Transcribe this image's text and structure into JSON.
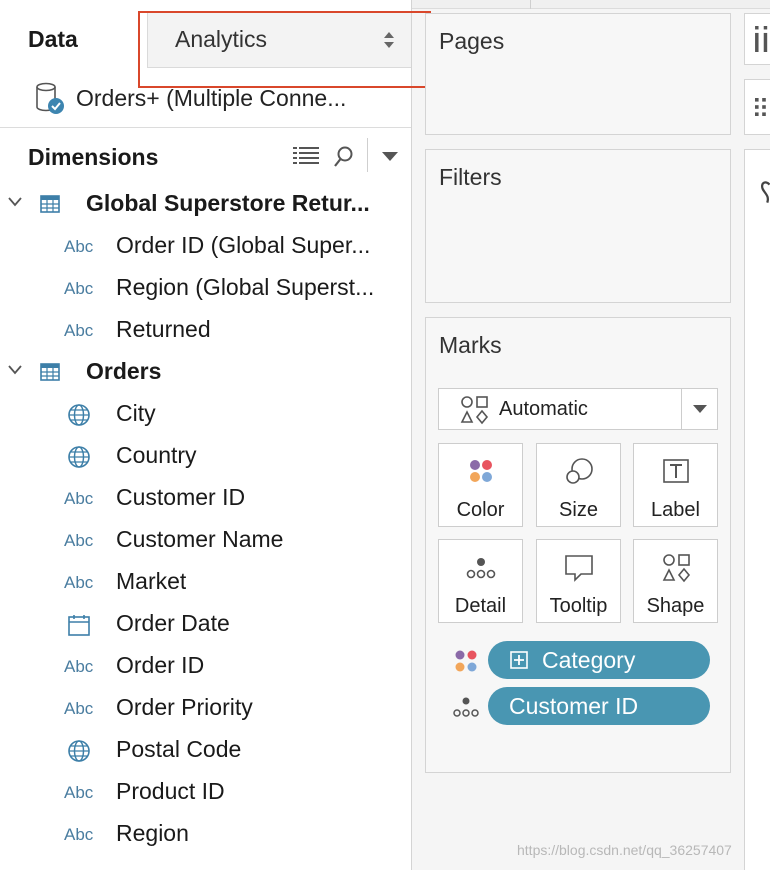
{
  "data_pane": {
    "tab_data": "Data",
    "tab_analytics": "Analytics",
    "datasource": "Orders+ (Multiple Conne...",
    "dimensions_title": "Dimensions"
  },
  "groups": [
    {
      "label": "Global Superstore Retur...",
      "fields": [
        {
          "type": "Abc",
          "name": "Order ID (Global Super..."
        },
        {
          "type": "Abc",
          "name": "Region (Global Superst..."
        },
        {
          "type": "Abc",
          "name": "Returned"
        }
      ]
    },
    {
      "label": "Orders",
      "fields": [
        {
          "type": "geo",
          "name": "City"
        },
        {
          "type": "geo",
          "name": "Country"
        },
        {
          "type": "Abc",
          "name": "Customer ID"
        },
        {
          "type": "Abc",
          "name": "Customer Name"
        },
        {
          "type": "Abc",
          "name": "Market"
        },
        {
          "type": "date",
          "name": "Order Date"
        },
        {
          "type": "Abc",
          "name": "Order ID"
        },
        {
          "type": "Abc",
          "name": "Order Priority"
        },
        {
          "type": "geo",
          "name": "Postal Code"
        },
        {
          "type": "Abc",
          "name": "Product ID"
        },
        {
          "type": "Abc",
          "name": "Region"
        }
      ]
    }
  ],
  "cards": {
    "pages": "Pages",
    "filters": "Filters",
    "marks": "Marks"
  },
  "marks": {
    "mark_type": "Automatic",
    "buttons": {
      "color": "Color",
      "size": "Size",
      "label": "Label",
      "detail": "Detail",
      "tooltip": "Tooltip",
      "shape": "Shape"
    },
    "pills": {
      "category": "Category",
      "customer_id": "Customer ID"
    }
  },
  "watermark": "https://blog.csdn.net/qq_36257407",
  "colors": {
    "pill": "#4996b2",
    "highlight": "#d9472b",
    "type_icon": "#4a7da0"
  }
}
